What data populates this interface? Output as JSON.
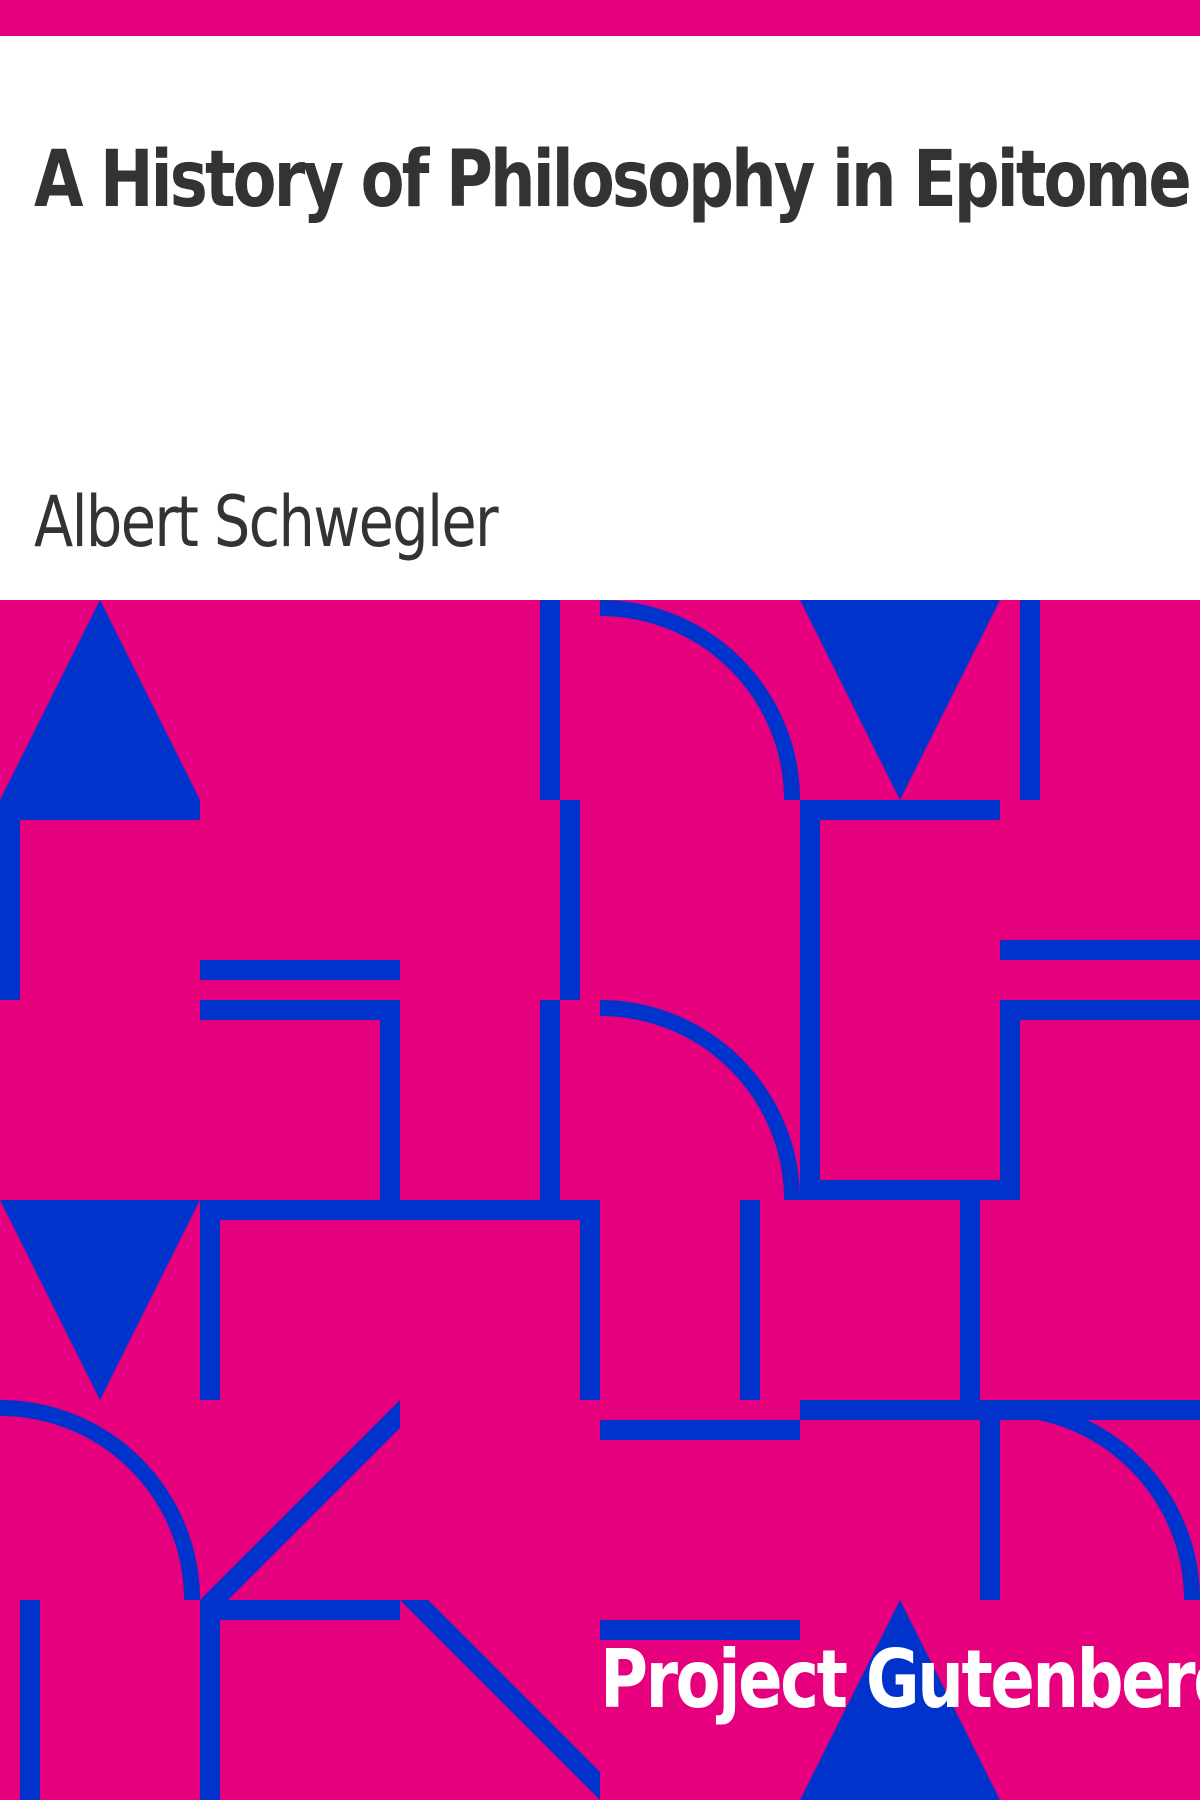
{
  "cover": {
    "title": "A History of Philosophy in Epitome",
    "author": "Albert Schwegler",
    "publisher": "Project Gutenberg"
  },
  "colors": {
    "background": "#e6007e",
    "pattern": "#0033cc",
    "panel": "#ffffff",
    "title_text": "#333333",
    "publisher_text": "#ffffff"
  },
  "pattern_icon": "geometric-pattern"
}
